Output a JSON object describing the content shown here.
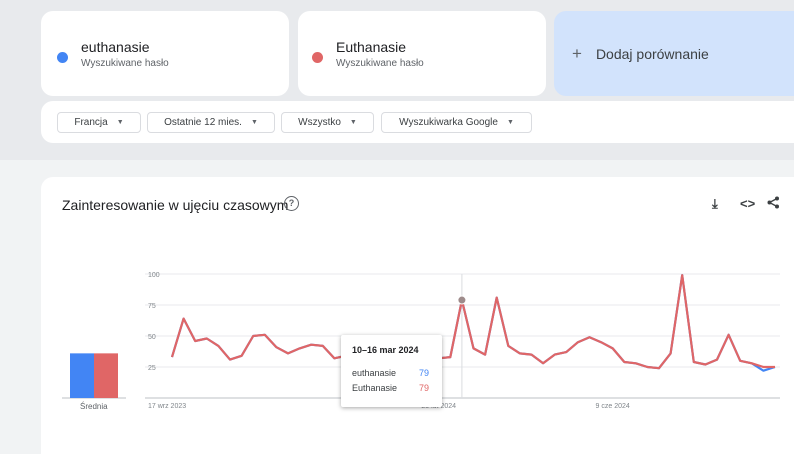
{
  "terms": [
    {
      "name": "euthanasie",
      "subtitle": "Wyszukiwane hasło",
      "color": "#4285f4"
    },
    {
      "name": "Euthanasie",
      "subtitle": "Wyszukiwane hasło",
      "color": "#e06666"
    }
  ],
  "add_compare": "Dodaj porównanie",
  "filters": [
    "Francja",
    "Ostatnie 12 mies.",
    "Wszystko",
    "Wyszukiwarka Google"
  ],
  "panel": {
    "title": "Zainteresowanie w ujęciu czasowym",
    "help_icon": "help-circle-icon",
    "tools": [
      "download-icon",
      "embed-code-icon",
      "share-icon"
    ]
  },
  "average": {
    "label": "Średnia",
    "values": [
      40,
      40
    ]
  },
  "tooltip": {
    "date": "10–16 mar 2024",
    "rows": [
      {
        "term": "euthanasie",
        "value": "79"
      },
      {
        "term": "Euthanasie",
        "value": "79"
      }
    ]
  },
  "chart_data": {
    "type": "line",
    "yticks": [
      25,
      50,
      75,
      100
    ],
    "ylim": [
      0,
      100
    ],
    "xtick_labels": [
      "17 wrz 2023",
      "25 lut 2024",
      "9 cze 2024"
    ],
    "xtick_indices": [
      0,
      23,
      38
    ],
    "highlight_index": 25,
    "series": [
      {
        "name": "euthanasie",
        "color": "#4285f4",
        "values": [
          33,
          64,
          46,
          48,
          42,
          31,
          34,
          50,
          51,
          41,
          36,
          40,
          43,
          42,
          32,
          34,
          36,
          39,
          41,
          38,
          37,
          37,
          32,
          32,
          33,
          79,
          40,
          35,
          81,
          42,
          36,
          35,
          28,
          35,
          37,
          45,
          49,
          45,
          40,
          29,
          28,
          25,
          24,
          36,
          99,
          29,
          27,
          31,
          51,
          30,
          28,
          22,
          25
        ]
      },
      {
        "name": "Euthanasie",
        "color": "#e06666",
        "values": [
          33,
          64,
          46,
          48,
          42,
          31,
          34,
          50,
          51,
          41,
          36,
          40,
          43,
          42,
          32,
          34,
          36,
          39,
          41,
          38,
          37,
          37,
          32,
          32,
          33,
          79,
          40,
          35,
          81,
          42,
          36,
          35,
          28,
          35,
          37,
          45,
          49,
          45,
          40,
          29,
          28,
          25,
          24,
          36,
          99,
          29,
          27,
          31,
          51,
          30,
          28,
          25,
          25
        ]
      }
    ]
  }
}
